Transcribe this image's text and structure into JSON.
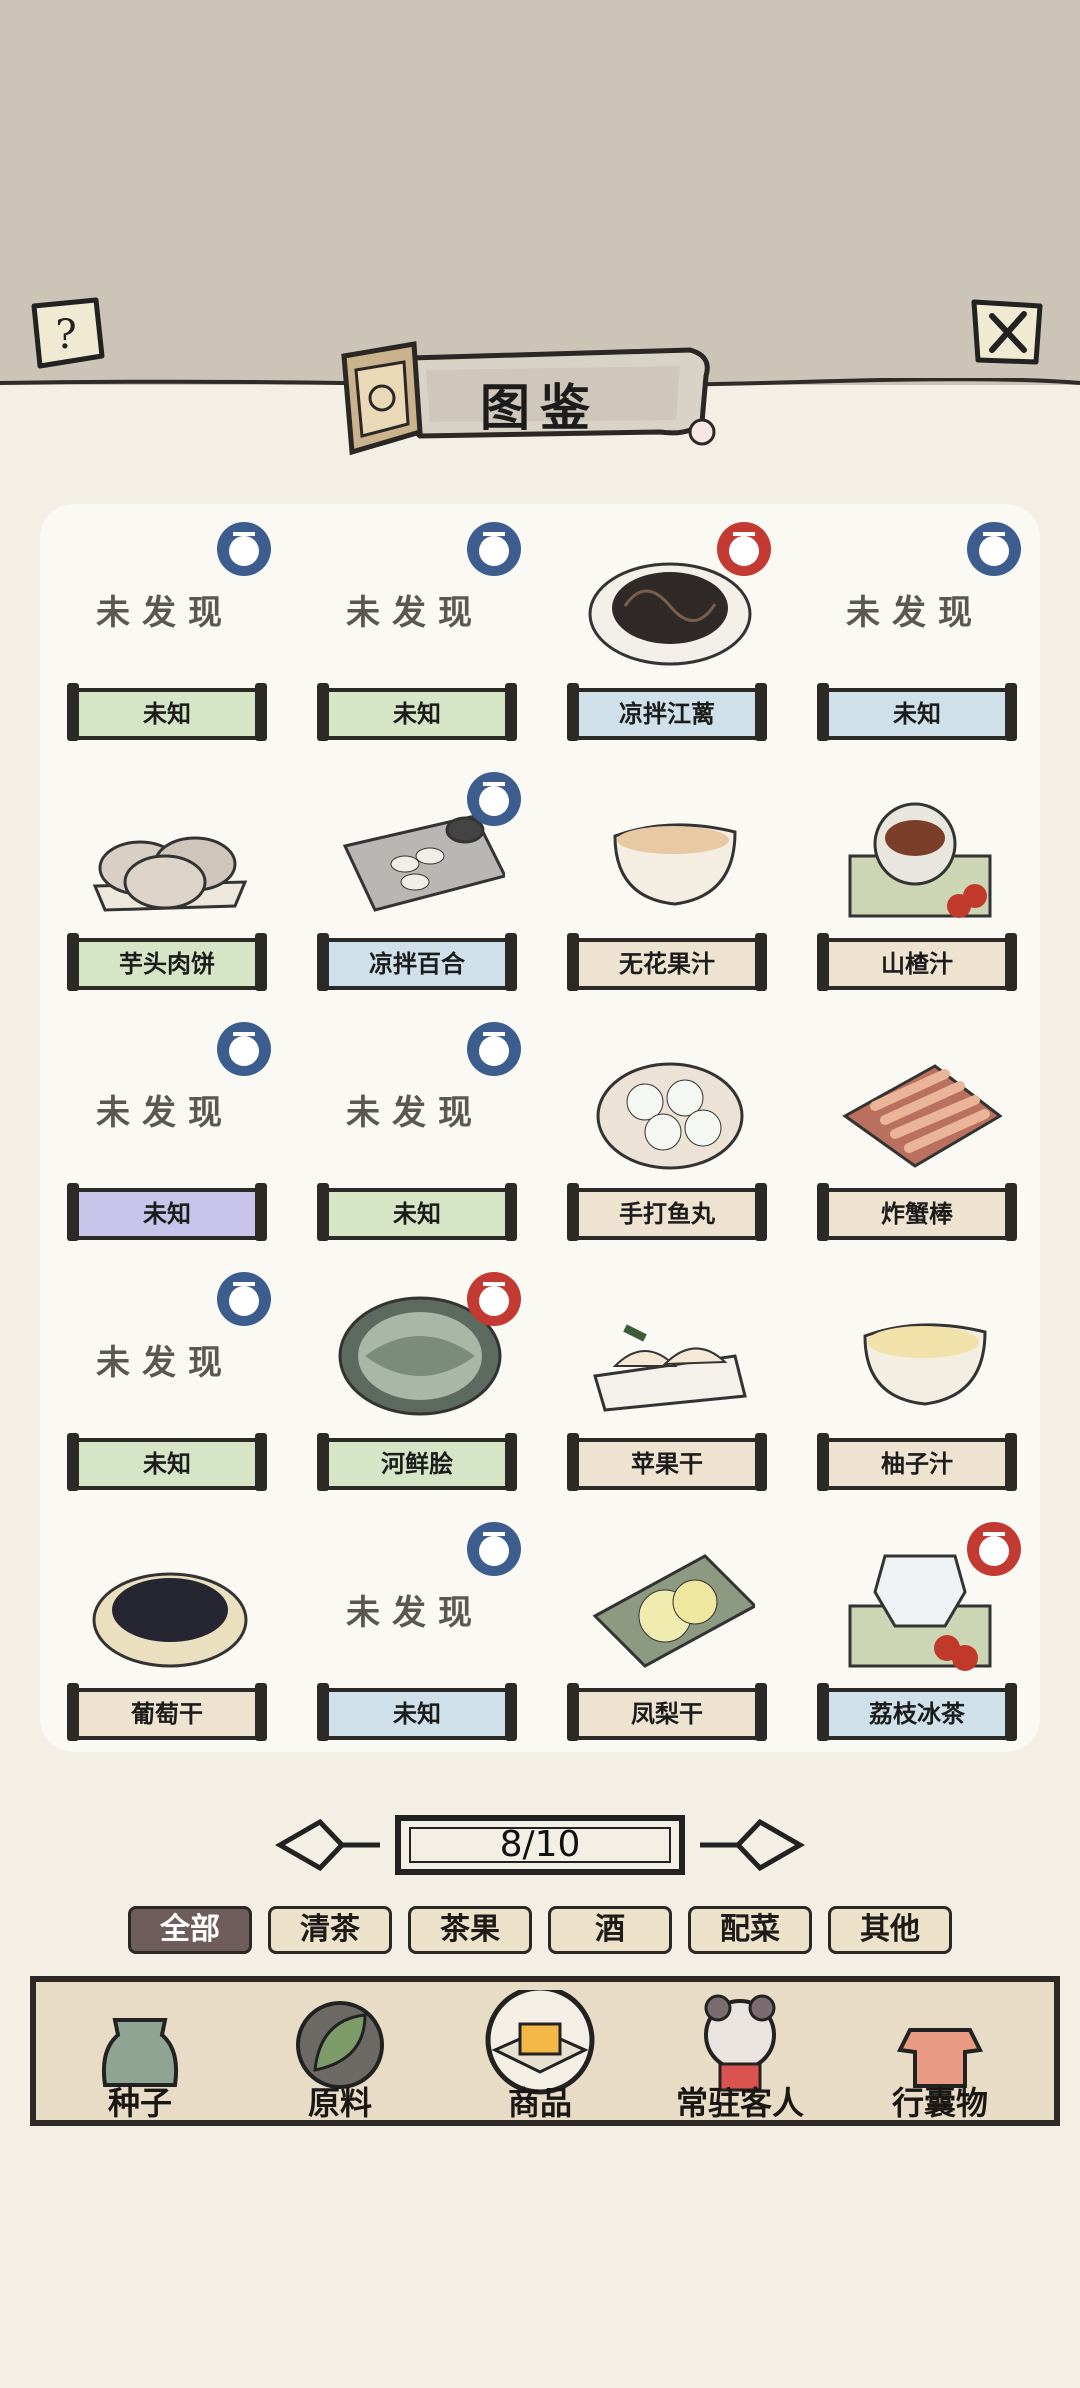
{
  "header": {
    "title": "图鉴"
  },
  "cards": [
    {
      "name": "未知",
      "status": "未发现",
      "plate": "green",
      "stamp": "blue",
      "art": "none"
    },
    {
      "name": "未知",
      "status": "未发现",
      "plate": "green",
      "stamp": "blue",
      "art": "none"
    },
    {
      "name": "凉拌江蓠",
      "status": "",
      "plate": "blue",
      "stamp": "red",
      "art": "seaweed"
    },
    {
      "name": "未知",
      "status": "未发现",
      "plate": "blue",
      "stamp": "blue",
      "art": "none"
    },
    {
      "name": "芋头肉饼",
      "status": "",
      "plate": "green",
      "stamp": "",
      "art": "patties"
    },
    {
      "name": "凉拌百合",
      "status": "",
      "plate": "blue",
      "stamp": "blue",
      "art": "lily"
    },
    {
      "name": "无花果汁",
      "status": "",
      "plate": "tan",
      "stamp": "",
      "art": "juice-orange"
    },
    {
      "name": "山楂汁",
      "status": "",
      "plate": "tan",
      "stamp": "",
      "art": "tea-cup"
    },
    {
      "name": "未知",
      "status": "未发现",
      "plate": "purple",
      "stamp": "blue",
      "art": "none"
    },
    {
      "name": "未知",
      "status": "未发现",
      "plate": "green",
      "stamp": "blue",
      "art": "none"
    },
    {
      "name": "手打鱼丸",
      "status": "",
      "plate": "tan",
      "stamp": "",
      "art": "fishballs"
    },
    {
      "name": "炸蟹棒",
      "status": "",
      "plate": "tan",
      "stamp": "",
      "art": "crabsticks"
    },
    {
      "name": "未知",
      "status": "未发现",
      "plate": "green",
      "stamp": "blue",
      "art": "none"
    },
    {
      "name": "河鲜脍",
      "status": "",
      "plate": "green",
      "stamp": "red",
      "art": "fish"
    },
    {
      "name": "苹果干",
      "status": "",
      "plate": "tan",
      "stamp": "",
      "art": "apple-slices"
    },
    {
      "name": "柚子汁",
      "status": "",
      "plate": "tan",
      "stamp": "",
      "art": "juice-yellow"
    },
    {
      "name": "葡萄干",
      "status": "",
      "plate": "tan",
      "stamp": "",
      "art": "raisins"
    },
    {
      "name": "未知",
      "status": "未发现",
      "plate": "blue",
      "stamp": "blue",
      "art": "none"
    },
    {
      "name": "凤梨干",
      "status": "",
      "plate": "tan",
      "stamp": "",
      "art": "pineapple"
    },
    {
      "name": "荔枝冰茶",
      "status": "",
      "plate": "blue",
      "stamp": "red",
      "art": "iced-tea"
    }
  ],
  "pager": {
    "text": "8/10"
  },
  "tabs": [
    {
      "label": "全部",
      "active": true
    },
    {
      "label": "清茶",
      "active": false
    },
    {
      "label": "茶果",
      "active": false
    },
    {
      "label": "酒",
      "active": false
    },
    {
      "label": "配菜",
      "active": false
    },
    {
      "label": "其他",
      "active": false
    }
  ],
  "bottom_nav": [
    {
      "label": "种子",
      "icon": "jar-icon"
    },
    {
      "label": "原料",
      "icon": "leaf-icon"
    },
    {
      "label": "商品",
      "icon": "goods-icon"
    },
    {
      "label": "常驻客人",
      "icon": "guest-icon"
    },
    {
      "label": "行囊物",
      "icon": "bag-icon"
    }
  ],
  "colors": {
    "plate_green": "#d6e5c6",
    "plate_blue": "#cfe0ea",
    "plate_tan": "#eee3d0",
    "plate_purple": "#c8c4ea",
    "stamp_blue": "#3d5d8e",
    "stamp_red": "#c23a32",
    "active_tab": "#6e5d5b"
  }
}
